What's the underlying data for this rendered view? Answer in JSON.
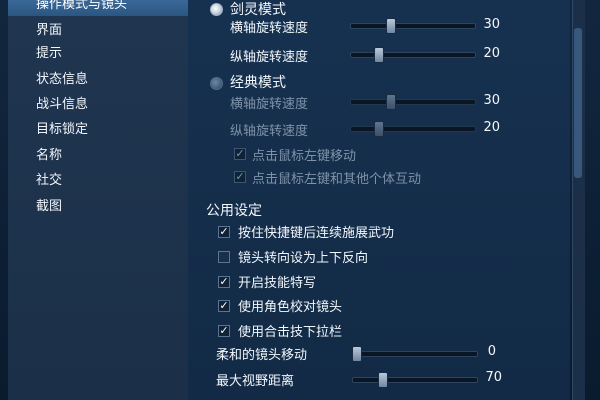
{
  "sidebar": {
    "items": [
      {
        "label": "操作模式与镜头",
        "active": true
      },
      {
        "label": "界面"
      },
      {
        "label": "提示"
      },
      {
        "label": "状态信息"
      },
      {
        "label": "战斗信息"
      },
      {
        "label": "目标锁定"
      },
      {
        "label": "名称"
      },
      {
        "label": "社交"
      },
      {
        "label": "截图"
      }
    ]
  },
  "mode_section": {
    "sword_mode": {
      "label": "剑灵模式",
      "selected": true,
      "horizontal": {
        "label": "横轴旋转速度",
        "value": "30",
        "level": 30
      },
      "vertical": {
        "label": "纵轴旋转速度",
        "value": "20",
        "level": 20
      }
    },
    "classic_mode": {
      "label": "经典模式",
      "selected": false,
      "horizontal": {
        "label": "横轴旋转速度",
        "value": "30",
        "level": 30
      },
      "vertical": {
        "label": "纵轴旋转速度",
        "value": "20",
        "level": 20
      },
      "options": [
        {
          "label": "点击鼠标左键移动",
          "checked": true
        },
        {
          "label": "点击鼠标左键和其他个体互动",
          "checked": true
        }
      ]
    }
  },
  "common_section": {
    "title": "公用设定",
    "options": [
      {
        "label": "按住快捷键后连续施展武功",
        "checked": true
      },
      {
        "label": "镜头转向设为上下反向",
        "checked": false
      },
      {
        "label": "开启技能特写",
        "checked": true
      },
      {
        "label": "使用角色校对镜头",
        "checked": true
      },
      {
        "label": "使用合击技下拉栏",
        "checked": true
      }
    ],
    "soft_camera": {
      "label": "柔和的镜头移动",
      "value": "0",
      "level": 0
    },
    "max_view": {
      "label": "最大视野距离",
      "value": "70",
      "level": 70
    }
  }
}
